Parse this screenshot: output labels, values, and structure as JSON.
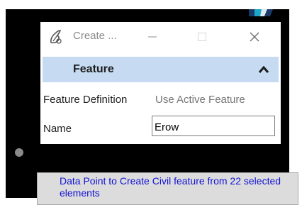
{
  "window": {
    "title": "Create ...",
    "app_icon": "civil-feature-icon",
    "controls": {
      "minimize_icon": "minimize-icon",
      "maximize_icon": "maximize-icon",
      "close_icon": "close-icon"
    }
  },
  "section": {
    "title": "Feature",
    "toggle_icon": "chevron-up-icon"
  },
  "fields": {
    "feature_definition": {
      "label": "Feature Definition",
      "value": "Use Active Feature"
    },
    "name": {
      "label": "Name",
      "value": "Erow"
    }
  },
  "status": {
    "prompt": "Data Point to Create Civil feature from 22 selected elements"
  },
  "colors": {
    "canvas_background": "#000000",
    "section_header": "#c6dbf2",
    "prompt_text": "#1212d6",
    "prompt_background": "#dcdcdc"
  }
}
